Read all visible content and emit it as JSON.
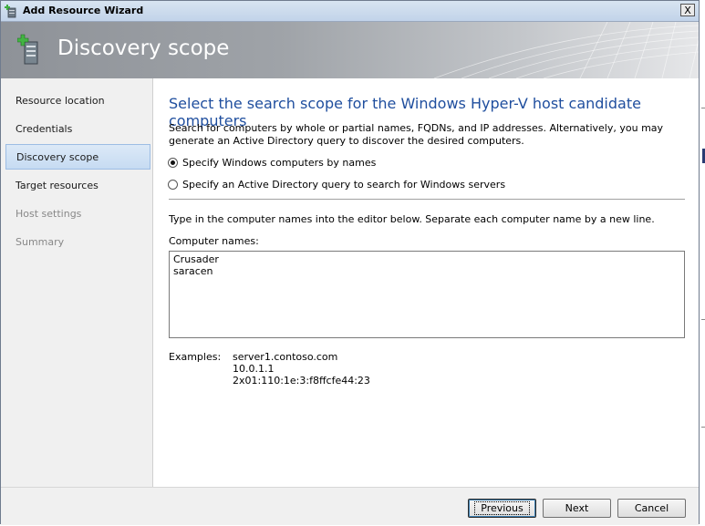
{
  "window": {
    "title": "Add Resource Wizard",
    "close_glyph": "X"
  },
  "header": {
    "title": "Discovery scope",
    "icon": "server-add-icon"
  },
  "nav": {
    "items": [
      {
        "label": "Resource location",
        "state": "normal"
      },
      {
        "label": "Credentials",
        "state": "normal"
      },
      {
        "label": "Discovery scope",
        "state": "active"
      },
      {
        "label": "Target resources",
        "state": "normal"
      },
      {
        "label": "Host settings",
        "state": "disabled"
      },
      {
        "label": "Summary",
        "state": "disabled"
      }
    ]
  },
  "content": {
    "title": "Select the search scope for the Windows Hyper-V host candidate computers",
    "description": "Search for computers by whole or partial names, FQDNs, and IP addresses. Alternatively, you may generate an Active Directory query to discover the desired computers.",
    "options": [
      {
        "label": "Specify Windows computers by names",
        "checked": true
      },
      {
        "label": "Specify an Active Directory query to search for Windows servers",
        "checked": false
      }
    ],
    "instruction": "Type in the computer names into the editor below. Separate each computer name by a new line.",
    "computer_names_label": "Computer names:",
    "computer_names": [
      "Crusader",
      "saracen"
    ],
    "examples_label": "Examples:",
    "examples": [
      "server1.contoso.com",
      "10.0.1.1",
      "2x01:110:1e:3:f8ffcfe44:23"
    ]
  },
  "footer": {
    "previous_label": "Previous",
    "next_label": "Next",
    "cancel_label": "Cancel"
  },
  "colors": {
    "title_blue": "#1f4e9e",
    "active_nav": "#c6dbf2"
  }
}
